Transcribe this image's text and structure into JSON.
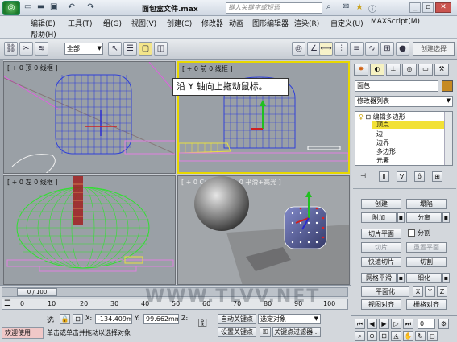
{
  "window": {
    "title": "面包盒文件.max",
    "search_placeholder": "键入关键字或短语"
  },
  "menu": {
    "items": [
      "编辑(E)",
      "工具(T)",
      "组(G)",
      "视图(V)",
      "创建(C)",
      "修改器",
      "动画",
      "图形编辑器",
      "渲染(R)",
      "自定义(U)",
      "MAXScript(M)",
      "帮助(H)"
    ]
  },
  "toolbar": {
    "selection_filter": "全部",
    "create_selection_set": "创建选择"
  },
  "tooltip": {
    "text": "沿 Y 轴向上拖动鼠标。"
  },
  "viewports": {
    "top_left": {
      "label": "[ + 0 顶 0 线框 ]"
    },
    "top_right": {
      "label": "[ + 0 前 0 线框 ]"
    },
    "bottom_left": {
      "label": "[ + 0 左 0 线框 ]"
    },
    "bottom_right": {
      "label": "[ + 0 Camera001 0 平滑+高光 ]"
    }
  },
  "command_panel": {
    "object_name": "面包",
    "object_color": "#c68a22",
    "modifier_list": "修改器列表",
    "stack": [
      "编辑多边形",
      "顶点",
      "边",
      "边界",
      "多边形",
      "元素"
    ],
    "selected_level": "顶点",
    "buttons": {
      "create": "创建",
      "collapse": "塌陷",
      "attach": "附加",
      "detach": "分离",
      "slice_plane": "切片平面",
      "split": "分割",
      "slice": "切片",
      "reset_plane": "重置平面",
      "quickslice": "快速切片",
      "cut": "切割",
      "msmooth": "网格平滑",
      "tessellate": "细化",
      "planarize": "平面化",
      "x": "X",
      "y": "Y",
      "z": "Z",
      "view_align": "视图对齐",
      "grid_align": "栅格对齐"
    }
  },
  "timeline": {
    "frame_counter": "0 / 100",
    "ticks": [
      "0",
      "10",
      "20",
      "30",
      "40",
      "50",
      "60",
      "70",
      "80",
      "90",
      "100"
    ]
  },
  "status": {
    "selection": "选",
    "x_label": "X:",
    "x_value": "-134.409m",
    "y_label": "Y:",
    "y_value": "99.662mm",
    "z_label": "Z:",
    "auto_key": "自动关键点",
    "key_mode": "选定对象",
    "set_key": "设置关键点",
    "key_filters": "关键点过滤器...",
    "welcome": "欢迎使用",
    "prompt": "单击或单击并拖动以选择对象",
    "frame": "0"
  },
  "watermark": {
    "text": "WWW.TLVV.NET"
  },
  "colors": {
    "accent_yellow": "#e8d800",
    "viewport_bg": "#9aa0a6",
    "selected_stack": "#f2e135"
  }
}
